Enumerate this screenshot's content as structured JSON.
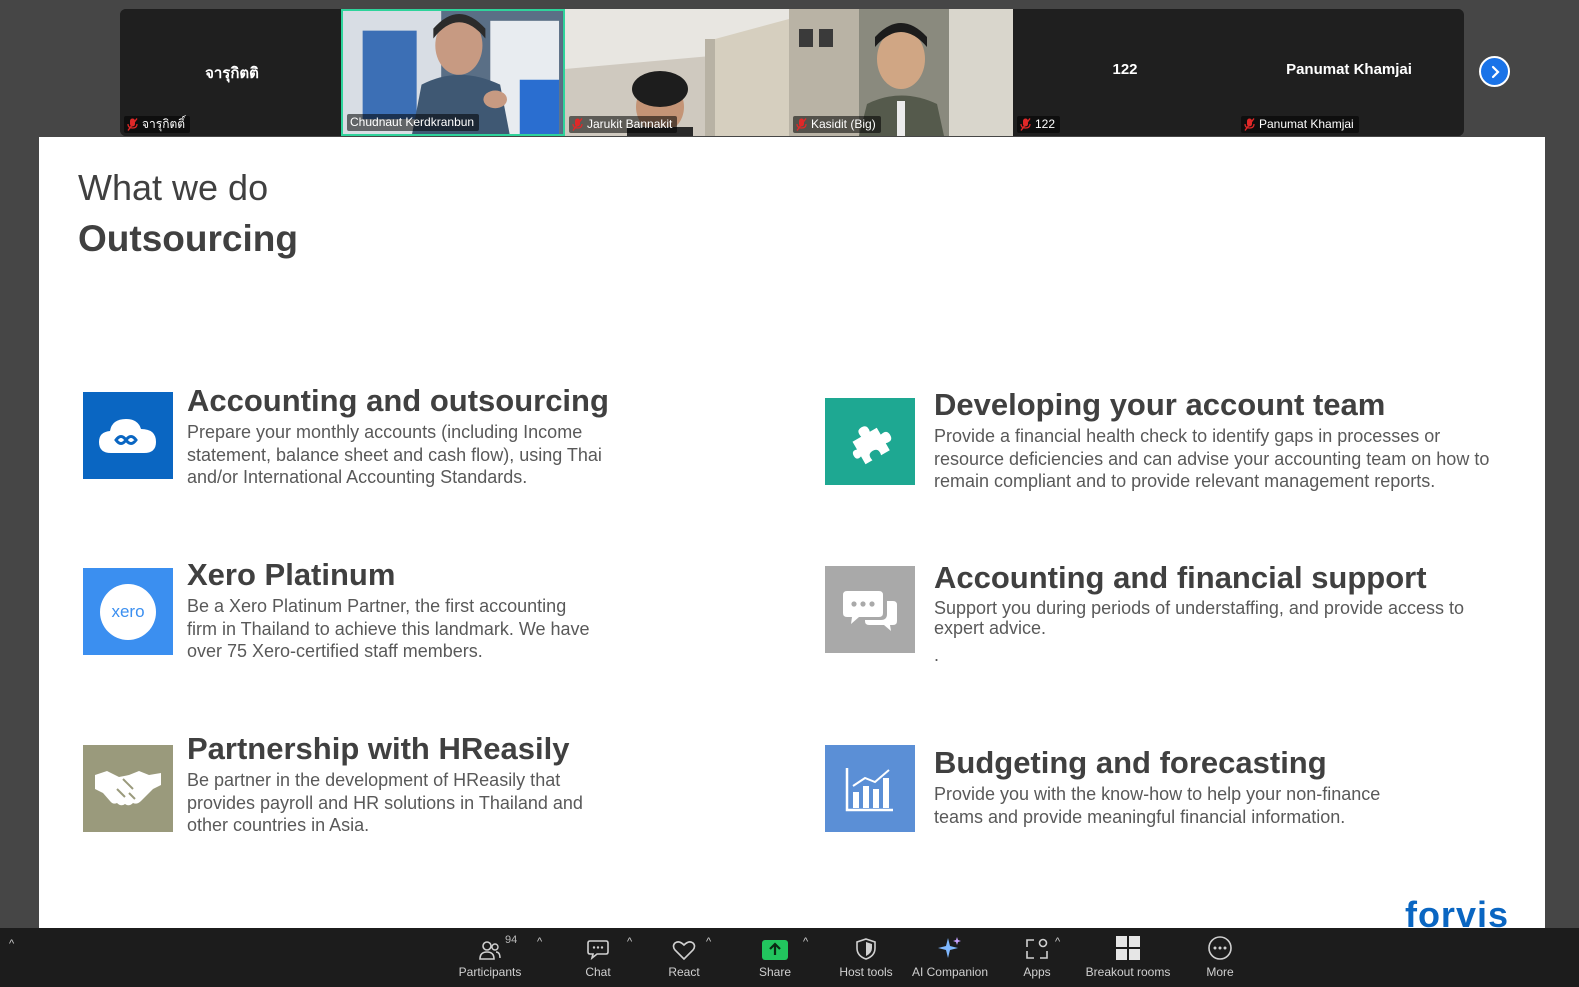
{
  "participants": [
    {
      "display": "จารุกิตติ",
      "tag": "จารุกิตติ์",
      "muted": true
    },
    {
      "display": "",
      "tag": "Chudnaut Kerdkranbun",
      "muted": false,
      "active": true
    },
    {
      "display": "",
      "tag": "Jarukit Bannakit",
      "muted": true
    },
    {
      "display": "",
      "tag": "Kasidit (Big)",
      "muted": true
    },
    {
      "display": "122",
      "tag": "122",
      "muted": true
    },
    {
      "display": "Panumat Khamjai",
      "tag": "Panumat Khamjai",
      "muted": true
    }
  ],
  "slide": {
    "title": "What we do",
    "subtitle": "Outsourcing",
    "logo": "forvis",
    "services": [
      {
        "heading": "Accounting and outsourcing",
        "description": "Prepare your monthly accounts (including Income statement, balance sheet and cash flow), using Thai and/or International Accounting Standards.",
        "icon": "cloud-link-icon",
        "color": "#0a66c2"
      },
      {
        "heading": "Developing your account team",
        "description": "Provide a financial health check to identify gaps in processes or resource deficiencies and can advise your accounting team on how to remain compliant and to provide relevant management reports.",
        "icon": "puzzle-piece-icon",
        "color": "#1ea892"
      },
      {
        "heading": "Xero Platinum",
        "description": "Be a Xero Platinum Partner, the first accounting firm in Thailand to achieve this landmark. We have over 75 Xero-certified staff members.",
        "icon": "xero-logo-icon",
        "color": "#3b8ff0",
        "icon_text": "xero"
      },
      {
        "heading": "Accounting and financial support",
        "description": "Support you during periods of understaffing, and provide access to expert advice.",
        "icon": "chat-bubbles-icon",
        "color": "#a9a9a9",
        "extra": "."
      },
      {
        "heading": "Partnership with HReasily",
        "description": "Be partner in the development of HReasily that provides payroll and HR solutions in Thailand and other countries in Asia.",
        "icon": "handshake-icon",
        "color": "#9a9a7c"
      },
      {
        "heading": "Budgeting and forecasting",
        "description": "Provide you with the know-how to help your non-finance teams and provide meaningful financial information.",
        "icon": "bar-chart-icon",
        "color": "#5b8fd6"
      }
    ]
  },
  "toolbar": {
    "participants_label": "Participants",
    "participants_count": "94",
    "chat_label": "Chat",
    "react_label": "React",
    "share_label": "Share",
    "host_tools_label": "Host tools",
    "ai_companion_label": "AI Companion",
    "apps_label": "Apps",
    "breakout_label": "Breakout rooms",
    "more_label": "More"
  },
  "colors": {
    "accent": "#1a73e8",
    "active_border": "#2fd39b",
    "share_green": "#22c55e"
  }
}
